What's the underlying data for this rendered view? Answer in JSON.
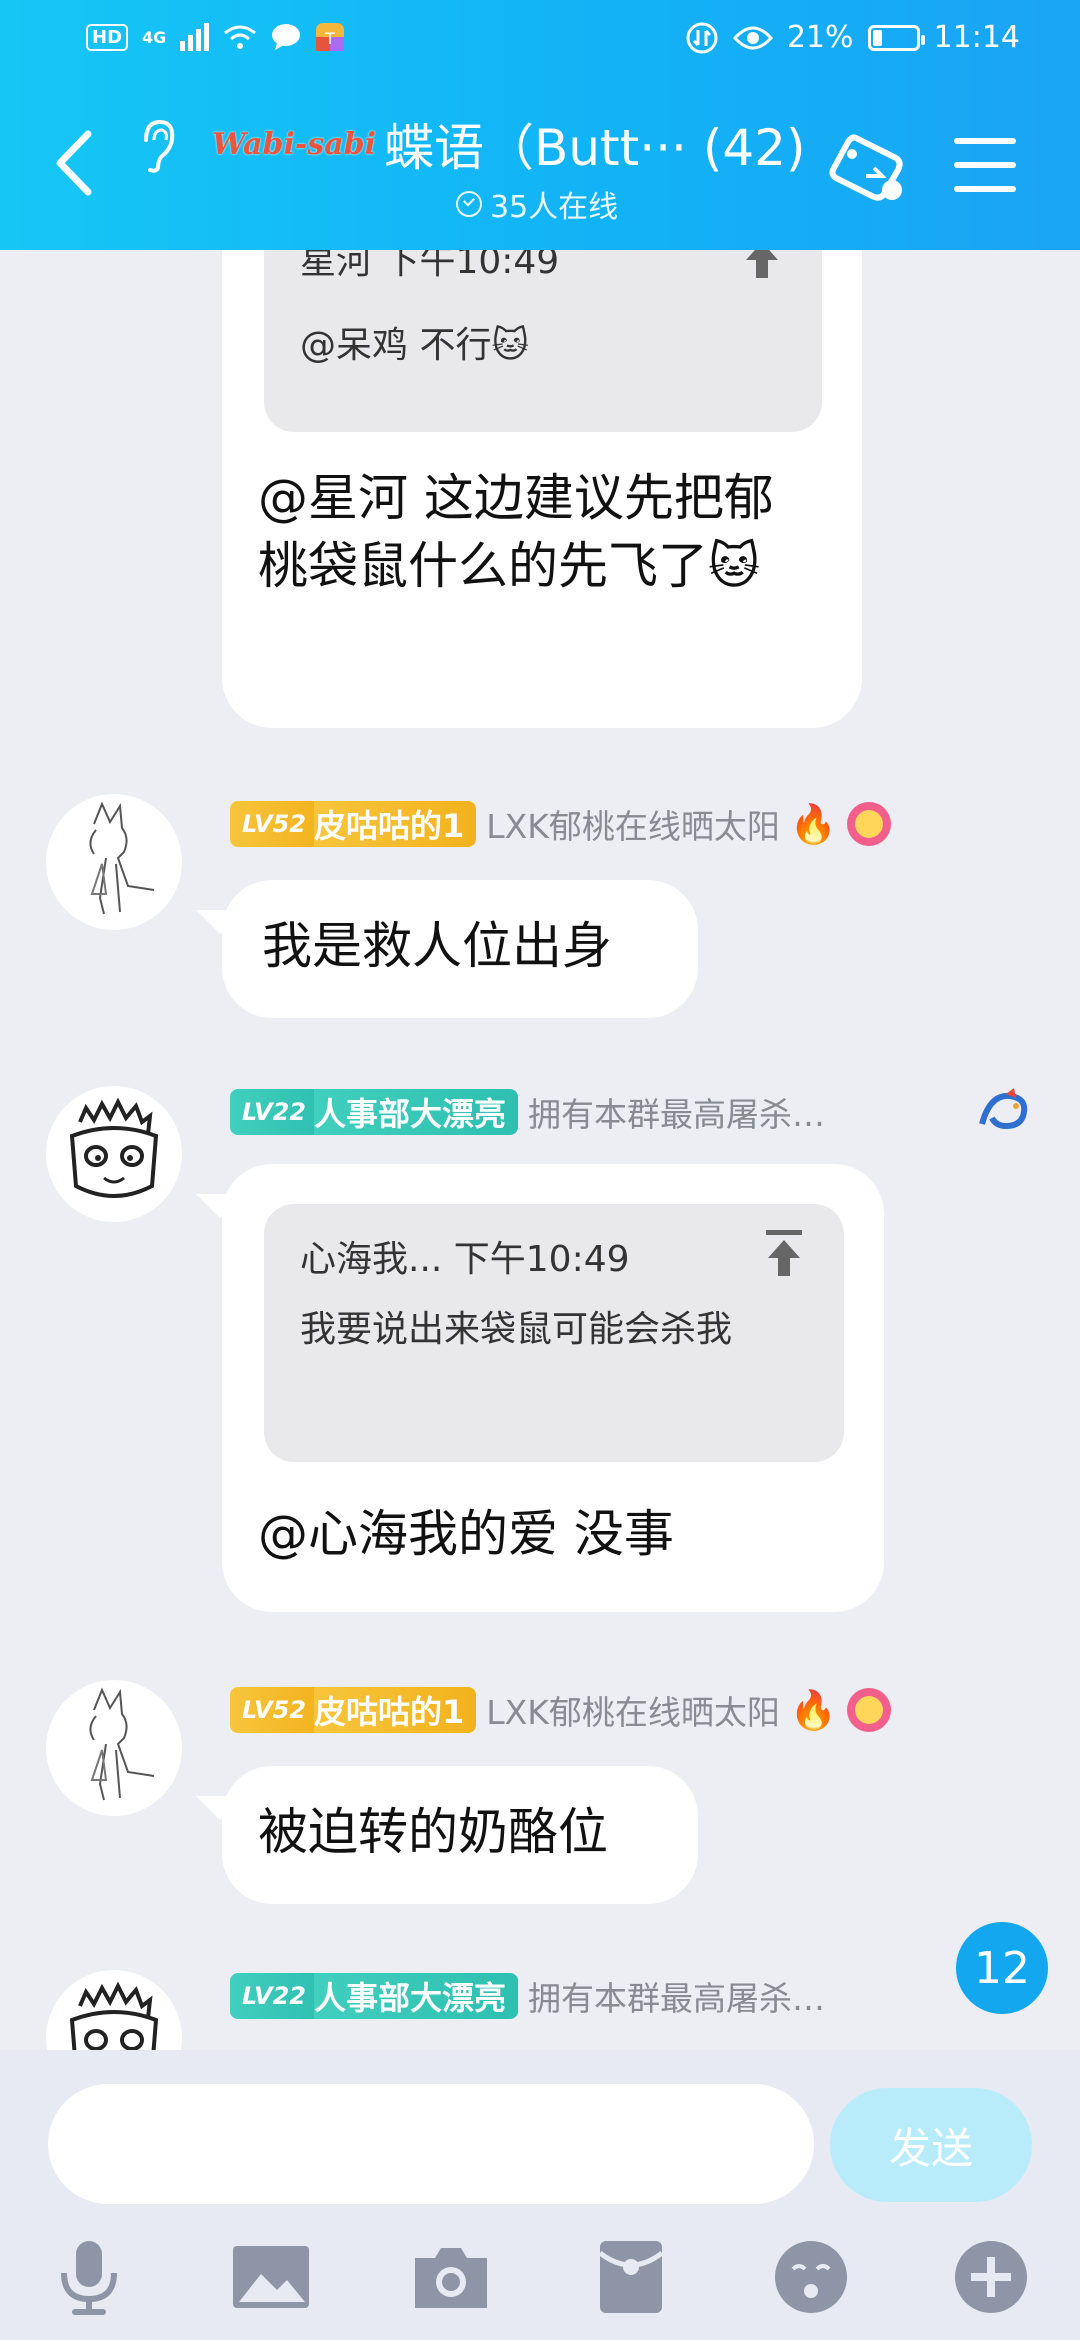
{
  "status_bar": {
    "hd_label": "HD",
    "network_label": "4G",
    "battery_percent": "21%",
    "battery_level": 0.21,
    "time": "11:14"
  },
  "header": {
    "group_logo_text": "Wabi-sabi",
    "group_name": "蝶语（Butt··· (42)",
    "online_status": "35人在线"
  },
  "messages": [
    {
      "quote": {
        "meta": "星河 下午10:49",
        "text": "@呆鸡 不行🐱"
      },
      "text": "@星河 这边建议先把郁桃袋鼠什么的先飞了🐱"
    },
    {
      "sender": {
        "level": "LV52",
        "name": "皮咕咕的1",
        "title": "LXK郁桃在线晒太阳",
        "badge": "🔥"
      },
      "text": "我是救人位出身"
    },
    {
      "sender": {
        "level": "LV22",
        "name": "人事部大漂亮",
        "title": "拥有本群最高屠杀…"
      },
      "quote": {
        "meta": "心海我... 下午10:49",
        "text": "我要说出来袋鼠可能会杀我"
      },
      "text": "@心海我的爱 没事"
    },
    {
      "sender": {
        "level": "LV52",
        "name": "皮咕咕的1",
        "title": "LXK郁桃在线晒太阳",
        "badge": "🔥"
      },
      "text": "被迫转的奶酪位"
    },
    {
      "sender": {
        "level": "LV22",
        "name": "人事部大漂亮",
        "title": "拥有本群最高屠杀…"
      }
    }
  ],
  "unread_count": "12",
  "composer": {
    "input_value": "",
    "send_label": "发送"
  },
  "toolbar": {
    "icons": [
      "microphone-icon",
      "image-icon",
      "camera-icon",
      "red-packet-icon",
      "emoji-icon",
      "plus-icon"
    ]
  },
  "colors": {
    "header_start": "#16c6f5",
    "header_end": "#1aa4f4",
    "chat_bg": "#eceef4",
    "level_gold": "#f2b21d",
    "level_teal": "#2ebfb0",
    "send_button": "#b9ecfb",
    "unread_badge": "#12a7ee"
  }
}
